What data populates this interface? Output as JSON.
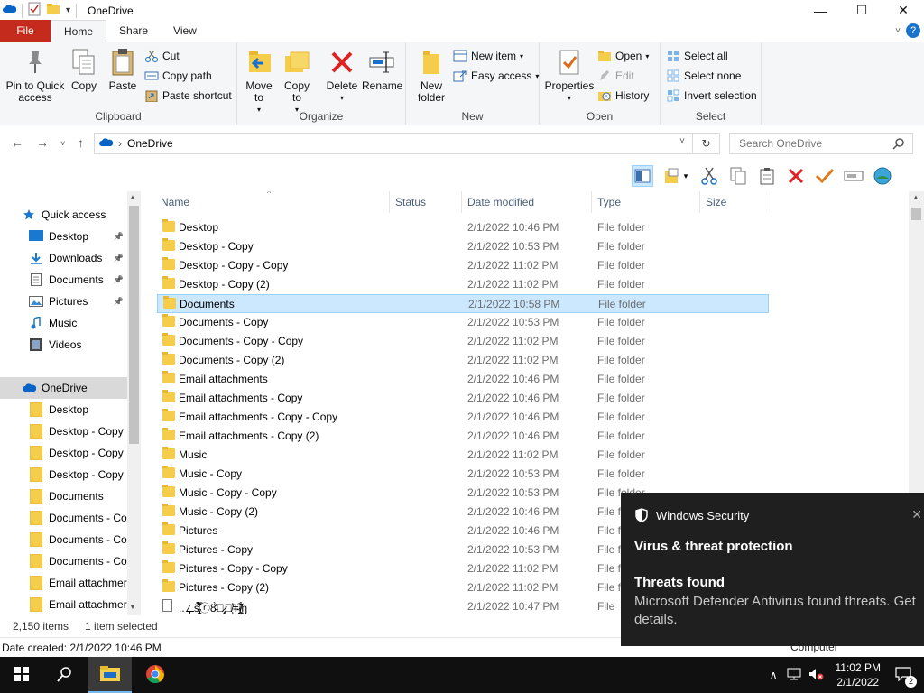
{
  "window": {
    "title": "OneDrive",
    "controls": {
      "minimize": "—",
      "maximize": "☐",
      "close": "✕"
    }
  },
  "ribbon_tabs": [
    "File",
    "Home",
    "Share",
    "View"
  ],
  "ribbon": {
    "clipboard": {
      "label": "Clipboard",
      "pin_to_quick_access": "Pin to Quick access",
      "copy": "Copy",
      "paste": "Paste",
      "cut": "Cut",
      "copy_path": "Copy path",
      "paste_shortcut": "Paste shortcut"
    },
    "organize": {
      "label": "Organize",
      "move_to": "Move to",
      "copy_to": "Copy to",
      "delete": "Delete",
      "rename": "Rename"
    },
    "new": {
      "label": "New",
      "new_folder": "New folder",
      "new_item": "New item",
      "easy_access": "Easy access"
    },
    "open": {
      "label": "Open",
      "properties": "Properties",
      "open": "Open",
      "edit": "Edit",
      "history": "History"
    },
    "select": {
      "label": "Select",
      "select_all": "Select all",
      "select_none": "Select none",
      "invert_selection": "Invert selection"
    }
  },
  "address": {
    "path": "OneDrive",
    "search_placeholder": "Search OneDrive"
  },
  "nav_pane": [
    {
      "label": "Quick access",
      "icon": "star-icon",
      "indent": 1,
      "pinned": false
    },
    {
      "label": "Desktop",
      "icon": "desktop-icon",
      "indent": 2,
      "pinned": true
    },
    {
      "label": "Downloads",
      "icon": "download-icon",
      "indent": 2,
      "pinned": true
    },
    {
      "label": "Documents",
      "icon": "document-icon",
      "indent": 2,
      "pinned": true
    },
    {
      "label": "Pictures",
      "icon": "pictures-icon",
      "indent": 2,
      "pinned": true
    },
    {
      "label": "Music",
      "icon": "music-icon",
      "indent": 2,
      "pinned": false
    },
    {
      "label": "Videos",
      "icon": "video-icon",
      "indent": 2,
      "pinned": false
    },
    {
      "label": "",
      "icon": "",
      "indent": 0,
      "pinned": false
    },
    {
      "label": "OneDrive",
      "icon": "cloud-icon",
      "indent": 1,
      "pinned": false
    },
    {
      "label": "Desktop",
      "icon": "folder-icon",
      "indent": 2,
      "pinned": false
    },
    {
      "label": "Desktop - Copy",
      "icon": "folder-icon",
      "indent": 2,
      "pinned": false
    },
    {
      "label": "Desktop - Copy",
      "icon": "folder-icon",
      "indent": 2,
      "pinned": false
    },
    {
      "label": "Desktop - Copy",
      "icon": "folder-icon",
      "indent": 2,
      "pinned": false
    },
    {
      "label": "Documents",
      "icon": "folder-icon",
      "indent": 2,
      "pinned": false
    },
    {
      "label": "Documents - Co",
      "icon": "folder-icon",
      "indent": 2,
      "pinned": false
    },
    {
      "label": "Documents - Co",
      "icon": "folder-icon",
      "indent": 2,
      "pinned": false
    },
    {
      "label": "Documents - Co",
      "icon": "folder-icon",
      "indent": 2,
      "pinned": false
    },
    {
      "label": "Email attachmer",
      "icon": "folder-icon",
      "indent": 2,
      "pinned": false
    },
    {
      "label": "Email attachmer",
      "icon": "folder-icon",
      "indent": 2,
      "pinned": false
    },
    {
      "label": "Email attachmer",
      "icon": "folder-icon",
      "indent": 2,
      "pinned": false
    }
  ],
  "columns": [
    "Name",
    "Status",
    "Date modified",
    "Type",
    "Size"
  ],
  "files": [
    {
      "name": "Desktop",
      "date": "2/1/2022 10:46 PM",
      "type": "File folder"
    },
    {
      "name": "Desktop - Copy",
      "date": "2/1/2022 10:53 PM",
      "type": "File folder"
    },
    {
      "name": "Desktop - Copy - Copy",
      "date": "2/1/2022 11:02 PM",
      "type": "File folder"
    },
    {
      "name": "Desktop - Copy (2)",
      "date": "2/1/2022 11:02 PM",
      "type": "File folder"
    },
    {
      "name": "Documents",
      "date": "2/1/2022 10:58 PM",
      "type": "File folder",
      "selected": true
    },
    {
      "name": "Documents - Copy",
      "date": "2/1/2022 10:53 PM",
      "type": "File folder"
    },
    {
      "name": "Documents - Copy - Copy",
      "date": "2/1/2022 11:02 PM",
      "type": "File folder"
    },
    {
      "name": "Documents - Copy (2)",
      "date": "2/1/2022 11:02 PM",
      "type": "File folder"
    },
    {
      "name": "Email attachments",
      "date": "2/1/2022 10:46 PM",
      "type": "File folder"
    },
    {
      "name": "Email attachments - Copy",
      "date": "2/1/2022 10:46 PM",
      "type": "File folder"
    },
    {
      "name": "Email attachments - Copy - Copy",
      "date": "2/1/2022 10:46 PM",
      "type": "File folder"
    },
    {
      "name": "Email attachments - Copy (2)",
      "date": "2/1/2022 10:46 PM",
      "type": "File folder"
    },
    {
      "name": "Music",
      "date": "2/1/2022 11:02 PM",
      "type": "File folder"
    },
    {
      "name": "Music - Copy",
      "date": "2/1/2022 10:53 PM",
      "type": "File folder"
    },
    {
      "name": "Music - Copy - Copy",
      "date": "2/1/2022 10:53 PM",
      "type": "File folder"
    },
    {
      "name": "Music - Copy (2)",
      "date": "2/1/2022 10:46 PM",
      "type": "File folder"
    },
    {
      "name": "Pictures",
      "date": "2/1/2022 10:46 PM",
      "type": "File folder"
    },
    {
      "name": "Pictures - Copy",
      "date": "2/1/2022 10:53 PM",
      "type": "File folder"
    },
    {
      "name": "Pictures - Copy - Copy",
      "date": "2/1/2022 11:02 PM",
      "type": "File folder"
    },
    {
      "name": "Pictures - Copy (2)",
      "date": "2/1/2022 11:02 PM",
      "type": "File folder"
    },
    {
      "name": "..ഺš̴̵̴̡̢̨̗̝̬͍̔̉̋͛͑̎̀̂͋̿ⓡȣ̴̀̕ՠ̷̨̡ﾈ̸͕̈̾ǂ̴̗̐ɉ̸̧̛̪͚̂͋̃́ŋ",
      "date": "2/1/2022 10:47 PM",
      "type": "File",
      "is_file": true
    }
  ],
  "status": {
    "item_count": "2,150 items",
    "selection": "1 item selected",
    "details": "Date created: 2/1/2022 10:46 PM"
  },
  "toast": {
    "app_name": "Windows Security",
    "title": "Virus & threat protection",
    "heading": "Threats found",
    "body": "Microsoft Defender Antivirus found threats. Get details.",
    "close": "✕"
  },
  "behind_toast_text": "Computer",
  "taskbar": {
    "time": "11:02 PM",
    "date": "2/1/2022",
    "notification_count": "2"
  }
}
